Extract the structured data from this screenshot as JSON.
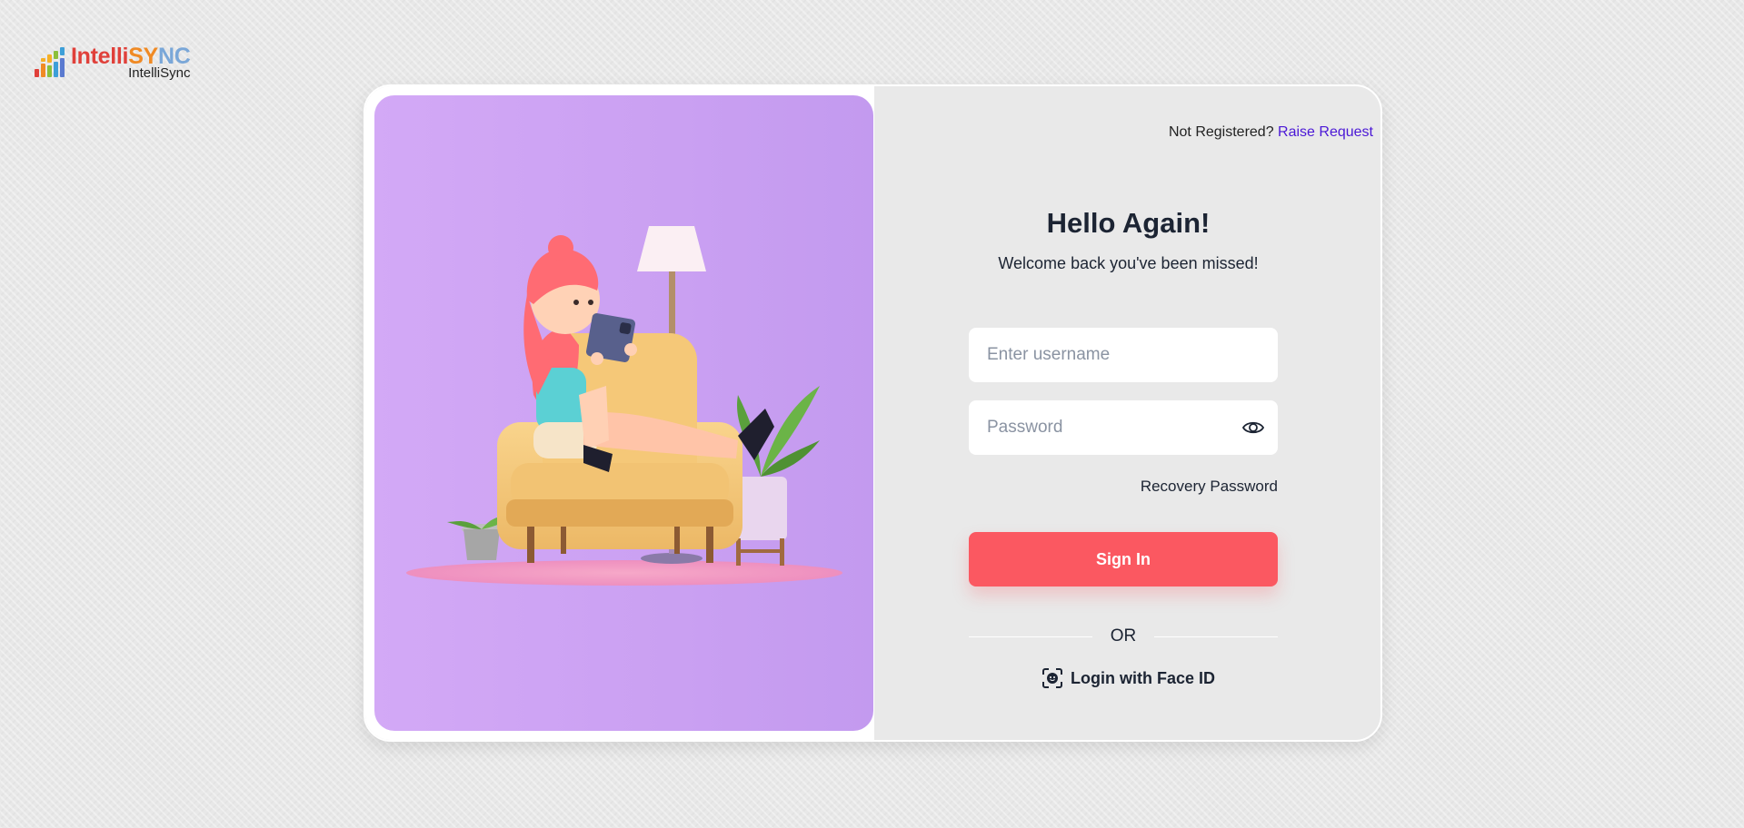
{
  "logo": {
    "brand_part1": "Intelli",
    "brand_part2": "SYNC",
    "subtitle": "IntelliSync",
    "icon": "bar-chart-logo-icon"
  },
  "illustration": {
    "description_icon": "girl-on-armchair-illustration",
    "background": "#caa0f2"
  },
  "header": {
    "not_registered": "Not Registered?",
    "raise_request": "Raise Request"
  },
  "login": {
    "title": "Hello Again!",
    "subtitle": "Welcome back you've been missed!",
    "username_placeholder": "Enter username",
    "password_placeholder": "Password",
    "recovery": "Recovery Password",
    "sign_in": "Sign In",
    "or": "OR",
    "face_id": "Login with Face ID"
  },
  "colors": {
    "accent": "#fb5861",
    "link": "#4b18d6",
    "panel": "#caa0f2"
  }
}
